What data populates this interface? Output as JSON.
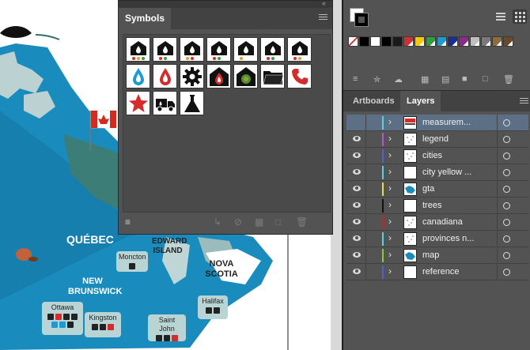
{
  "map": {
    "labels": {
      "quebec": "QUÉBEC",
      "new_brunswick": "NEW\nBRUNSWICK",
      "pei": "PRINCE\nEDWARD\nISLAND",
      "nova_scotia": "NOVA\nSCOTIA"
    },
    "cities": [
      {
        "key": "ottawa",
        "name": "Ottawa"
      },
      {
        "key": "kingston",
        "name": "Kingston"
      },
      {
        "key": "moncton",
        "name": "Moncton"
      },
      {
        "key": "halifax",
        "name": "Halifax"
      },
      {
        "key": "saint_john",
        "name": "Saint John"
      }
    ]
  },
  "symbols_panel": {
    "title": "Symbols",
    "icons": [
      "house-drop-icon",
      "house-drop-icon",
      "house-drop-icon",
      "house-drop-icon",
      "house-drop-icon",
      "house-drop-icon",
      "house-drop-icon",
      "water-drop-icon",
      "oil-drop-icon",
      "gear-icon",
      "house-flame-icon",
      "house-circle-icon",
      "folder-icon",
      "phone-icon",
      "star-icon",
      "truck-icon",
      "flask-icon"
    ]
  },
  "swatches_panel": {
    "colors": [
      "#ffffff",
      "#000000",
      "#ffffff",
      "#000000",
      "#1a1a1a",
      "#d32f2f",
      "#f6c800",
      "#2e9e3e",
      "#1a9bd7",
      "#1f2c8f",
      "#8e2a8e",
      "#bfbfbf",
      "#7a7a7a",
      "#8f6a3a",
      "#6a4a2a"
    ]
  },
  "layers_panel": {
    "tabs": [
      {
        "label": "Artboards",
        "active": false
      },
      {
        "label": "Layers",
        "active": true
      }
    ],
    "layers": [
      {
        "name": "measurem...",
        "color": "#4fd6e0",
        "selected": true,
        "thumb": "flag"
      },
      {
        "name": "legend",
        "color": "#c050d8",
        "selected": false,
        "thumb": "dots"
      },
      {
        "name": "cities",
        "color": "#4a62e0",
        "selected": false,
        "thumb": "dots"
      },
      {
        "name": "city yellow ...",
        "color": "#4fd6e0",
        "selected": false,
        "thumb": "blank"
      },
      {
        "name": "gta",
        "color": "#e8e030",
        "selected": false,
        "thumb": "map"
      },
      {
        "name": "trees",
        "color": "#111111",
        "selected": false,
        "thumb": "blank"
      },
      {
        "name": "canadiana",
        "color": "#d02020",
        "selected": false,
        "thumb": "dots"
      },
      {
        "name": "provinces n...",
        "color": "#4fd6e0",
        "selected": false,
        "thumb": "dots"
      },
      {
        "name": "map",
        "color": "#8acd2e",
        "selected": false,
        "thumb": "map"
      },
      {
        "name": "reference",
        "color": "#4a62e0",
        "selected": false,
        "thumb": "blank"
      }
    ]
  }
}
